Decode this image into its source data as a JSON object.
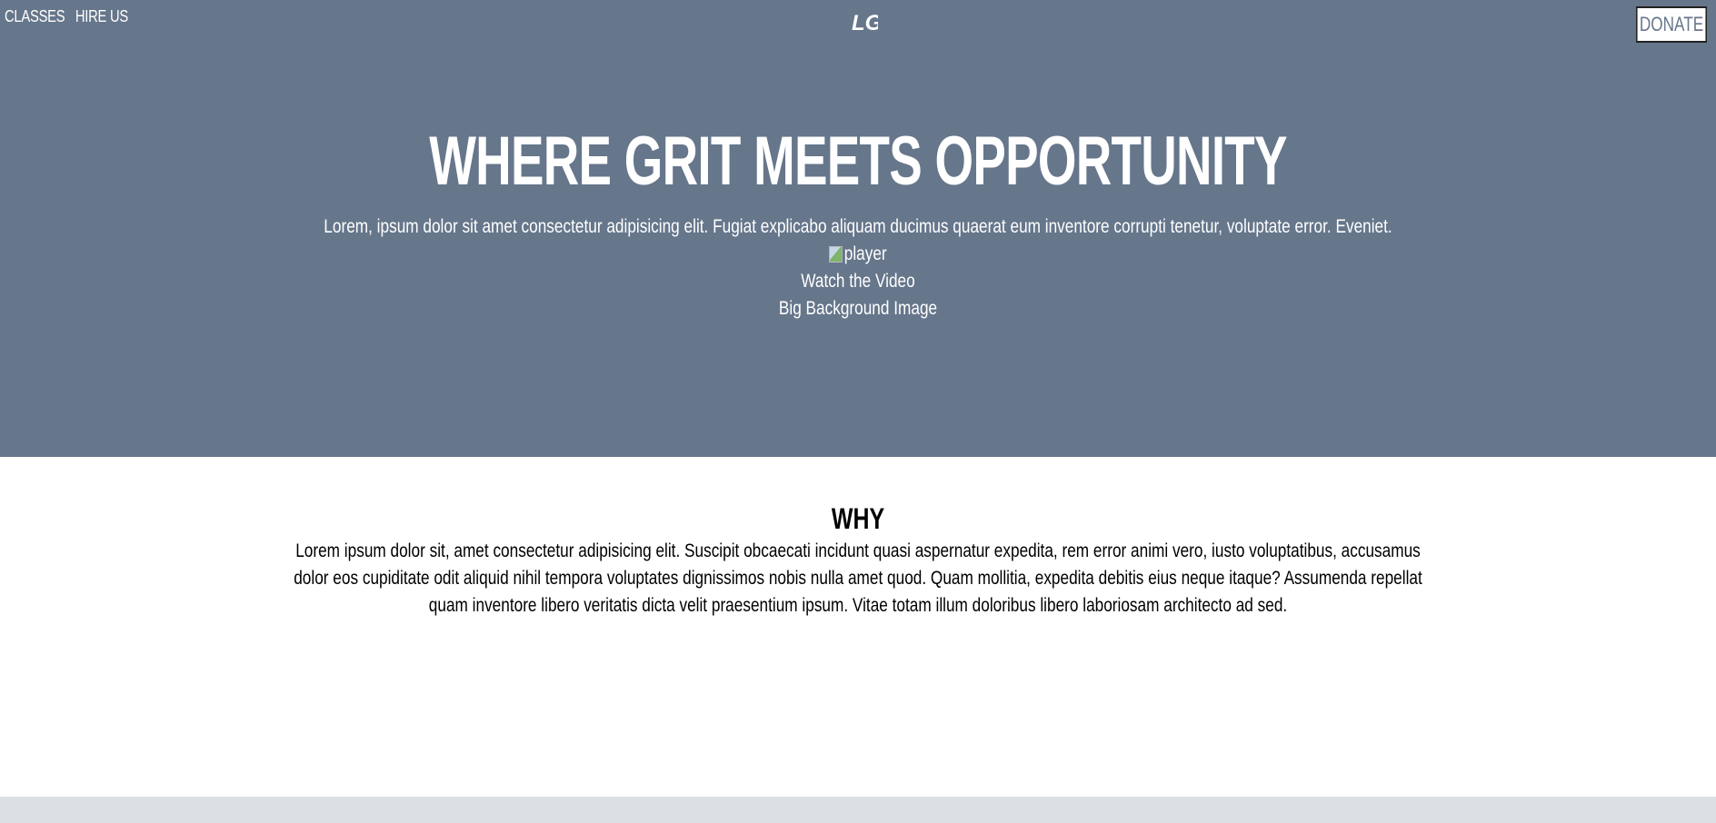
{
  "nav": {
    "links": [
      "CLASSES",
      "HIRE US"
    ],
    "logo_text": "LG",
    "donate_label": "DONATE"
  },
  "hero": {
    "title": "WHERE GRIT MEETS OPPORTUNITY",
    "subtitle": "Lorem, ipsum dolor sit amet consectetur adipisicing elit. Fugiat explicabo aliquam ducimus quaerat eum inventore corrupti tenetur, voluptate error. Eveniet.",
    "player_alt": "player",
    "watch_label": "Watch the Video",
    "background_label": "Big Background Image",
    "bg_color": "#66768b"
  },
  "why": {
    "title": "WHY",
    "text": "Lorem ipsum dolor sit, amet consectetur adipisicing elit. Suscipit obcaecati incidunt quasi aspernatur expedita, rem error animi vero, iusto voluptatibus, accusamus dolor eos cupiditate odit aliquid nihil tempora voluptates dignissimos nobis nulla amet quod. Quam mollitia, expedita debitis eius neque itaque? Assumenda repellat quam inventore libero veritatis dicta velit praesentium ipsum. Vitae totam illum doloribus libero laboriosam architecto ad sed."
  },
  "footer": {
    "bg_color": "#dce0e4"
  }
}
